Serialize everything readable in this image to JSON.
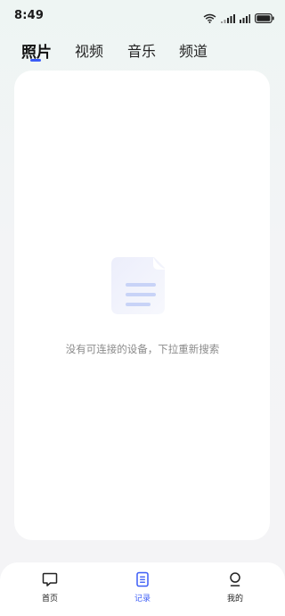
{
  "status_bar": {
    "time": "8:49",
    "icons": [
      "wifi-icon",
      "signal-icon",
      "signal-icon",
      "battery-icon"
    ]
  },
  "tabs": [
    {
      "label": "照片",
      "active": true
    },
    {
      "label": "视频",
      "active": false
    },
    {
      "label": "音乐",
      "active": false
    },
    {
      "label": "频道",
      "active": false
    }
  ],
  "empty_state": {
    "icon": "document-icon",
    "message": "没有可连接的设备，下拉重新搜索"
  },
  "bottom_nav": [
    {
      "label": "首页",
      "icon": "chat-bubble-icon",
      "active": false
    },
    {
      "label": "记录",
      "icon": "document-list-icon",
      "active": true
    },
    {
      "label": "我的",
      "icon": "user-icon",
      "active": false
    }
  ],
  "colors": {
    "accent": "#3b5cf6",
    "text_primary": "#111111",
    "text_secondary": "#8a8a8a",
    "card_bg": "#ffffff"
  }
}
